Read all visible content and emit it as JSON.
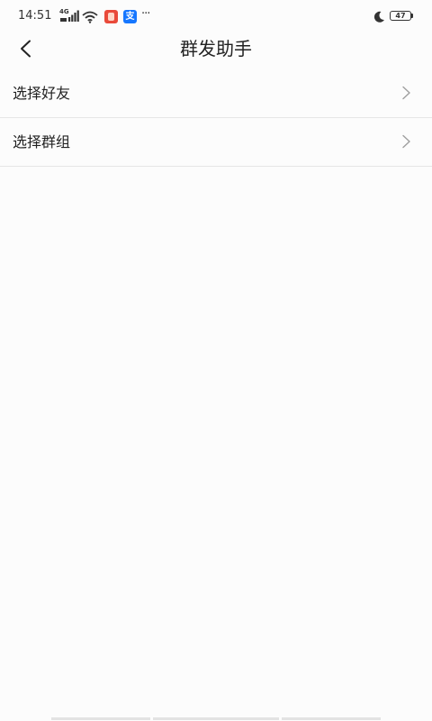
{
  "status_bar": {
    "time": "14:51",
    "network_type": "4G",
    "icons": [
      "signal-4g-icon",
      "wifi-icon",
      "app-notification-icon",
      "alipay-notification-icon",
      "more-notifications-icon",
      "moon-icon",
      "battery-icon"
    ],
    "alipay_glyph": "支",
    "more": "···",
    "battery": "47"
  },
  "header": {
    "back_icon": "chevron-left-icon",
    "title": "群发助手"
  },
  "menu": {
    "items": [
      {
        "label": "选择好友",
        "icon": "chevron-right-icon"
      },
      {
        "label": "选择群组",
        "icon": "chevron-right-icon"
      }
    ]
  },
  "colors": {
    "background": "#fcfcfc",
    "text": "#222222",
    "chevron": "#9e9e9e",
    "divider": "#e6e6e6",
    "alipay_blue": "#1677ff",
    "app_red": "#e94a3a"
  }
}
